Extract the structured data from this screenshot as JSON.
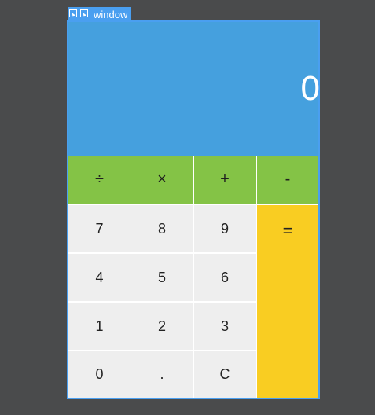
{
  "window": {
    "title": "window"
  },
  "display": {
    "value": "0"
  },
  "operators": [
    {
      "label": "÷",
      "name": "divide-button"
    },
    {
      "label": "×",
      "name": "multiply-button"
    },
    {
      "label": "+",
      "name": "add-button"
    },
    {
      "label": "-",
      "name": "subtract-button"
    }
  ],
  "keys": {
    "k7": "7",
    "k8": "8",
    "k9": "9",
    "k4": "4",
    "k5": "5",
    "k6": "6",
    "k1": "1",
    "k2": "2",
    "k3": "3",
    "k0": "0",
    "dot": ".",
    "clear": "C",
    "equals": "="
  },
  "colors": {
    "display_bg": "#45a0de",
    "operator_bg": "#84c346",
    "number_bg": "#eeeeee",
    "equals_bg": "#f9cd22",
    "window_border": "#4a9ff0"
  }
}
